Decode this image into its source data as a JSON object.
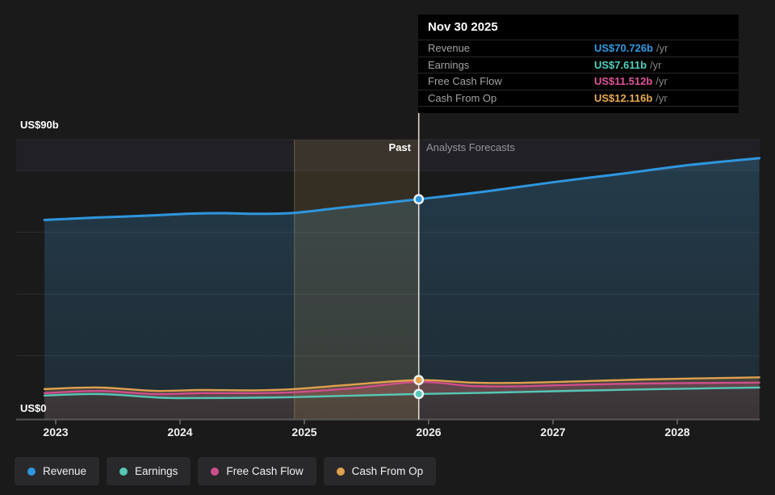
{
  "tooltip": {
    "title": "Nov 30 2025",
    "rows": [
      {
        "label": "Revenue",
        "value": "US$70.726b",
        "unit": "/yr",
        "color": "#2e9be6"
      },
      {
        "label": "Earnings",
        "value": "US$7.611b",
        "unit": "/yr",
        "color": "#53d0bd"
      },
      {
        "label": "Free Cash Flow",
        "value": "US$11.512b",
        "unit": "/yr",
        "color": "#e0569a"
      },
      {
        "label": "Cash From Op",
        "value": "US$12.116b",
        "unit": "/yr",
        "color": "#e9ab52"
      }
    ]
  },
  "legend": {
    "items": [
      {
        "label": "Revenue",
        "color": "#2e96dd"
      },
      {
        "label": "Earnings",
        "color": "#56c7b6"
      },
      {
        "label": "Free Cash Flow",
        "color": "#cf4f8d"
      },
      {
        "label": "Cash From Op",
        "color": "#e0a14e"
      }
    ]
  },
  "chart_data": {
    "type": "area",
    "title": "",
    "y_axis": {
      "label_top": "US$90b",
      "label_zero": "US$0",
      "range": [
        0,
        90
      ],
      "gridline_values": [
        20,
        40,
        60,
        80,
        90
      ]
    },
    "x_axis": {
      "ticks": [
        2023,
        2024,
        2025,
        2026,
        2027,
        2028
      ],
      "range": [
        2022.91,
        2028.66
      ]
    },
    "divider": {
      "x": 2025.92,
      "date": "Nov 30 2025",
      "label_past": "Past",
      "label_forecast": "Analysts Forecasts",
      "color": "rgba(243,235,224,0.9)"
    },
    "highlight": {
      "from": 2024.92,
      "to": 2025.92,
      "color": "rgba(199,157,83,0.16)",
      "edge_color": "rgba(214,182,126,0.35)"
    },
    "series": [
      {
        "name": "Revenue",
        "color": "#2e96dd",
        "line_width": 3,
        "marker": true,
        "unit": "US$ billions / yr",
        "fill": {
          "top_color": "#3a8cbe",
          "top_opacity": 0.3,
          "bottom_color": "#3a8cbe",
          "bottom_opacity": 0.15
        },
        "points": [
          [
            2022.91,
            64.0
          ],
          [
            2023.35,
            64.8
          ],
          [
            2023.8,
            65.5
          ],
          [
            2024.05,
            66.0
          ],
          [
            2024.35,
            66.2
          ],
          [
            2024.6,
            66.0
          ],
          [
            2024.92,
            66.3
          ],
          [
            2025.3,
            68.0
          ],
          [
            2025.6,
            69.3
          ],
          [
            2025.92,
            70.726
          ],
          [
            2026.45,
            73.2
          ],
          [
            2027.0,
            76.2
          ],
          [
            2027.6,
            79.2
          ],
          [
            2028.1,
            81.8
          ],
          [
            2028.66,
            84.0
          ]
        ]
      },
      {
        "name": "Cash From Op",
        "color": "#e0a14e",
        "line_width": 2.4,
        "marker": true,
        "unit": "US$ billions / yr",
        "fill": {
          "top_color": "#e0a14e",
          "top_opacity": 0.2,
          "bottom_color": "#e0a14e",
          "bottom_opacity": 0.2
        },
        "points": [
          [
            2022.91,
            9.2
          ],
          [
            2023.35,
            9.7
          ],
          [
            2023.8,
            8.6
          ],
          [
            2024.17,
            8.9
          ],
          [
            2024.6,
            8.8
          ],
          [
            2024.92,
            9.2
          ],
          [
            2025.4,
            10.7
          ],
          [
            2025.92,
            12.116
          ],
          [
            2026.35,
            11.3
          ],
          [
            2026.7,
            11.2
          ],
          [
            2027.1,
            11.6
          ],
          [
            2027.7,
            12.3
          ],
          [
            2028.66,
            13.0
          ]
        ]
      },
      {
        "name": "Free Cash Flow",
        "color": "#cf4f8d",
        "line_width": 2.4,
        "marker": false,
        "unit": "US$ billions / yr",
        "fill": {
          "top_color": "#cf4f8d",
          "top_opacity": 0.2,
          "bottom_color": "#cf4f8d",
          "bottom_opacity": 0.2
        },
        "points": [
          [
            2022.91,
            7.9
          ],
          [
            2023.35,
            8.6
          ],
          [
            2023.8,
            7.6
          ],
          [
            2024.17,
            7.9
          ],
          [
            2024.6,
            7.9
          ],
          [
            2024.92,
            8.2
          ],
          [
            2025.4,
            9.5
          ],
          [
            2025.92,
            11.512
          ],
          [
            2026.35,
            10.2
          ],
          [
            2026.7,
            10.1
          ],
          [
            2027.1,
            10.5
          ],
          [
            2027.7,
            11.0
          ],
          [
            2028.66,
            11.3
          ]
        ]
      },
      {
        "name": "Earnings",
        "color": "#56c7b6",
        "line_width": 2.4,
        "marker": true,
        "unit": "US$ billions / yr",
        "fill": {
          "top_color": "#707074",
          "top_opacity": 0.85,
          "bottom_color": "#303032",
          "bottom_opacity": 0.82
        },
        "points": [
          [
            2022.91,
            7.1
          ],
          [
            2023.35,
            7.6
          ],
          [
            2023.85,
            6.4
          ],
          [
            2024.17,
            6.3
          ],
          [
            2024.6,
            6.4
          ],
          [
            2024.92,
            6.6
          ],
          [
            2025.4,
            7.1
          ],
          [
            2025.92,
            7.611
          ],
          [
            2026.45,
            8.0
          ],
          [
            2027.0,
            8.5
          ],
          [
            2027.6,
            9.0
          ],
          [
            2028.1,
            9.35
          ],
          [
            2028.66,
            9.7
          ]
        ]
      }
    ]
  }
}
